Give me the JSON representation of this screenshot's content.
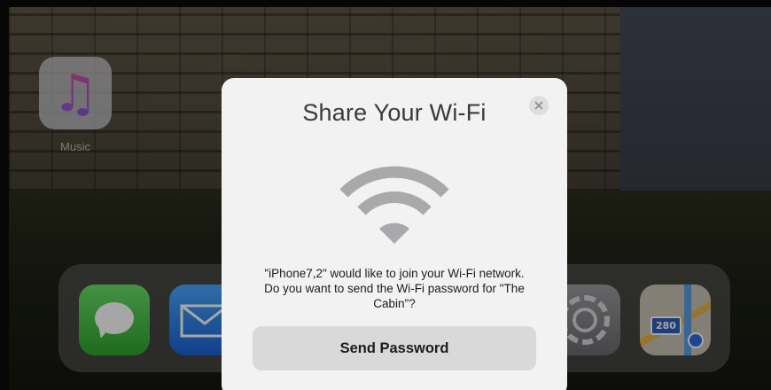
{
  "home_screen": {
    "apps": [
      {
        "name": "Music",
        "label": "Music",
        "icon": "music-note-icon"
      }
    ],
    "dock": [
      {
        "icon": "messages-icon"
      },
      {
        "icon": "mail-icon"
      },
      {
        "icon": "settings-icon"
      },
      {
        "icon": "maps-icon",
        "shield_text": "280"
      }
    ]
  },
  "alert": {
    "title": "Share Your Wi-Fi",
    "close_icon": "close-icon",
    "icon": "wifi-icon",
    "message": "\"iPhone7,2\" would like to join your Wi-Fi network. Do you want to send the Wi-Fi password for \"The Cabin\"?",
    "primary_button": "Send Password"
  }
}
